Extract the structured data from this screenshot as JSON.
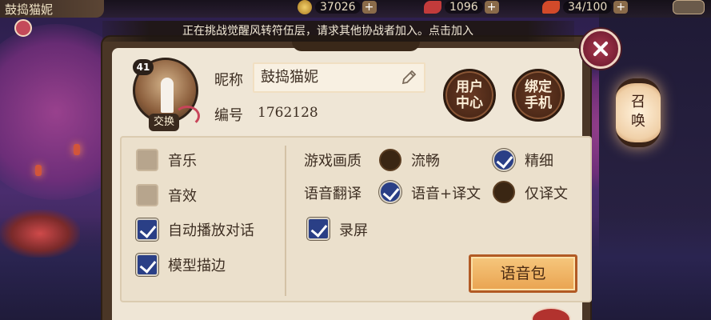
{
  "topbar": {
    "player_name": "鼓捣猫妮",
    "coins": "37026",
    "tickets": "1096",
    "stamina": "34/100"
  },
  "notice": {
    "text": "正在挑战觉醒风转符伍层，请求其他协战者加入。点击加入"
  },
  "profile": {
    "level": "41",
    "swap_label": "交换",
    "nickname_label": "昵称",
    "nickname_value": "鼓捣猫妮",
    "id_label": "编号",
    "id_value": "1762128",
    "user_center_label": "用户\n中心",
    "bind_phone_label": "绑定\n手机"
  },
  "settings": {
    "music_label": "音乐",
    "music_on": false,
    "sfx_label": "音效",
    "sfx_on": false,
    "auto_dialog_label": "自动播放对话",
    "auto_dialog_on": true,
    "model_outline_label": "模型描边",
    "model_outline_on": true,
    "quality_label": "游戏画质",
    "quality_options": [
      "流畅",
      "精细"
    ],
    "quality_selected": "精细",
    "voice_translation_label": "语音翻译",
    "voice_translation_options": [
      "语音+译文",
      "仅译文"
    ],
    "voice_translation_selected": "语音+译文",
    "record_label": "录屏",
    "record_on": true,
    "voice_pack_label": "语音包"
  },
  "side": {
    "summon_label": "召唤"
  },
  "colors": {
    "accent_blue": "#2a3f86",
    "panel_bg": "#efe6d6",
    "button_brown": "#4b2817",
    "voice_pack_orange": "#e9a350"
  }
}
